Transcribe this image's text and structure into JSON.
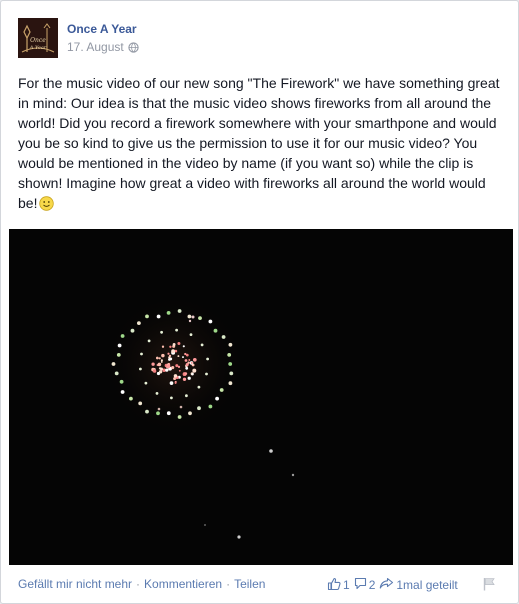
{
  "post": {
    "page_name": "Once A Year",
    "avatar_text": "Once A Year",
    "date": "17. August",
    "text": "For the music video of our new song \"The Firework\" we have something great in mind: Our idea is that the music video shows fireworks from all around the world! Did you record a firework somewhere with your smarthpone and would you be so kind to give us the permission to use it for our music video? You would be mentioned in the video by name (if you want so) while the clip is shown! Imagine how great a video with fireworks all around the world would be!"
  },
  "actions": {
    "unlike": "Gefällt mir nicht mehr",
    "comment": "Kommentieren",
    "share": "Teilen",
    "separator": "·"
  },
  "stats": {
    "likes": "1",
    "comments": "2",
    "shares": "1mal geteilt"
  },
  "colors": {
    "link": "#3b5998",
    "meta": "#9197a3",
    "text": "#141823",
    "action": "#5b7bb0"
  }
}
